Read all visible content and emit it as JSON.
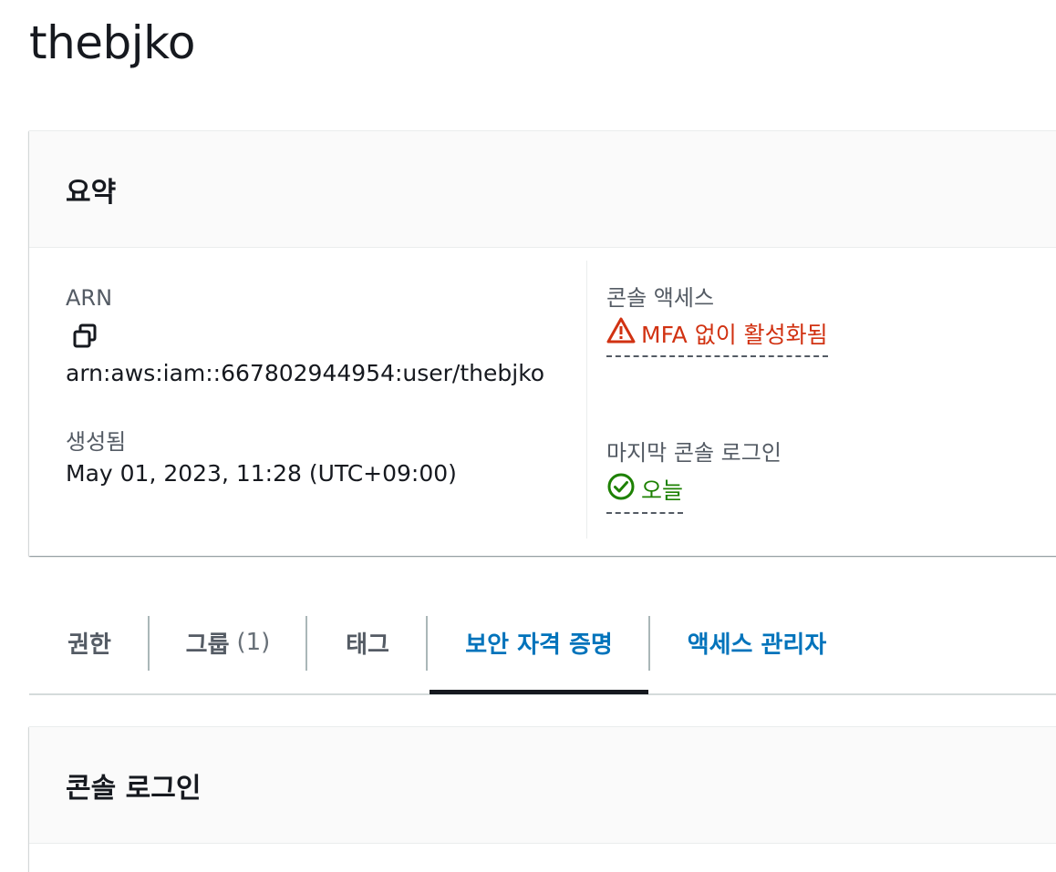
{
  "page": {
    "title": "thebjko"
  },
  "summary": {
    "heading": "요약",
    "arn_label": "ARN",
    "arn_value": "arn:aws:iam::667802944954:user/thebjko",
    "created_label": "생성됨",
    "created_value": "May 01, 2023, 11:28 (UTC+09:00)",
    "console_access_label": "콘솔 액세스",
    "console_access_value": "MFA 없이 활성화됨",
    "last_login_label": "마지막 콘솔 로그인",
    "last_login_value": "오늘"
  },
  "tabs": [
    {
      "label": "권한",
      "count": ""
    },
    {
      "label": "그룹",
      "count": "(1)"
    },
    {
      "label": "태그",
      "count": ""
    },
    {
      "label": "보안 자격 증명",
      "count": ""
    },
    {
      "label": "액세스 관리자",
      "count": ""
    }
  ],
  "active_tab": "보안 자격 증명",
  "console_login": {
    "heading": "콘솔 로그인"
  },
  "colors": {
    "accent": "#0073bb",
    "error": "#d13212",
    "success": "#1d8102",
    "text": "#16191f"
  },
  "icons": {
    "copy": "copy-icon",
    "warning": "warning-icon",
    "success": "check-circle-icon"
  }
}
